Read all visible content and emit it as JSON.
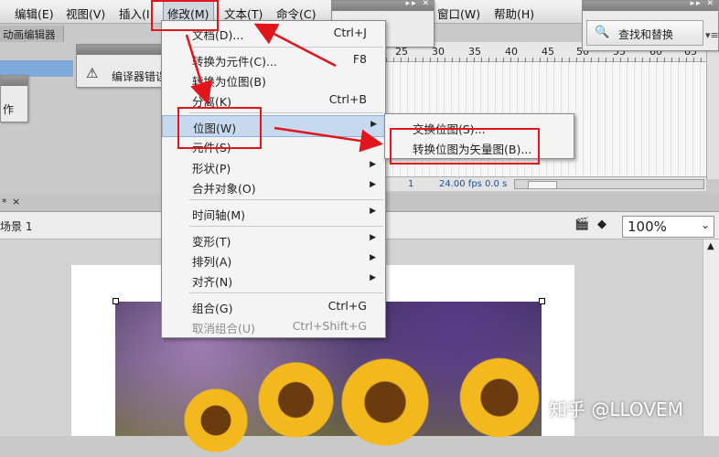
{
  "menubar": {
    "items": [
      {
        "label": "编辑(E)"
      },
      {
        "label": "视图(V)"
      },
      {
        "label": "插入(I"
      },
      {
        "label": "修改(M)"
      },
      {
        "label": "文本(T)"
      },
      {
        "label": "命令(C)"
      },
      {
        "label": "窗口(W)"
      },
      {
        "label": "帮助(H)"
      }
    ]
  },
  "timeline": {
    "tab_label": "动画编辑器",
    "frame_numbers": [
      "25",
      "30",
      "35",
      "40",
      "45",
      "50",
      "55",
      "60",
      "65"
    ],
    "status": {
      "frame": "1",
      "fps": "24.00 fps",
      "time": "0.0 s"
    }
  },
  "panels": {
    "compiler_errors": "编译器错误",
    "left_fragment": "作",
    "find_replace": "查找和替换"
  },
  "document": {
    "scene_label": "场景 1",
    "zoom": "100%",
    "tab_marker": "*",
    "tab_close": "×"
  },
  "modify_menu": {
    "items": [
      {
        "label": "文档(D)...",
        "shortcut": "Ctrl+J"
      },
      {
        "label": "转换为元件(C)...",
        "shortcut": "F8"
      },
      {
        "label": "转换为位图(B)",
        "shortcut": ""
      },
      {
        "label": "分离(K)",
        "shortcut": "Ctrl+B"
      },
      {
        "label": "位图(W)",
        "shortcut": ""
      },
      {
        "label": "元件(S)",
        "shortcut": ""
      },
      {
        "label": "形状(P)",
        "shortcut": ""
      },
      {
        "label": "合并对象(O)",
        "shortcut": ""
      },
      {
        "label": "时间轴(M)",
        "shortcut": ""
      },
      {
        "label": "变形(T)",
        "shortcut": ""
      },
      {
        "label": "排列(A)",
        "shortcut": ""
      },
      {
        "label": "对齐(N)",
        "shortcut": ""
      },
      {
        "label": "组合(G)",
        "shortcut": "Ctrl+G"
      },
      {
        "label": "取消组合(U)",
        "shortcut": "Ctrl+Shift+G"
      }
    ]
  },
  "bitmap_submenu": {
    "items": [
      {
        "label": "交换位图(S)..."
      },
      {
        "label": "转换位图为矢量图(B)..."
      }
    ]
  },
  "watermark": "知乎 @LLOVEM",
  "colors": {
    "highlight": "#c6d9ef",
    "annotation_red": "#e0161c",
    "frame_blue": "#7fa9d8"
  }
}
